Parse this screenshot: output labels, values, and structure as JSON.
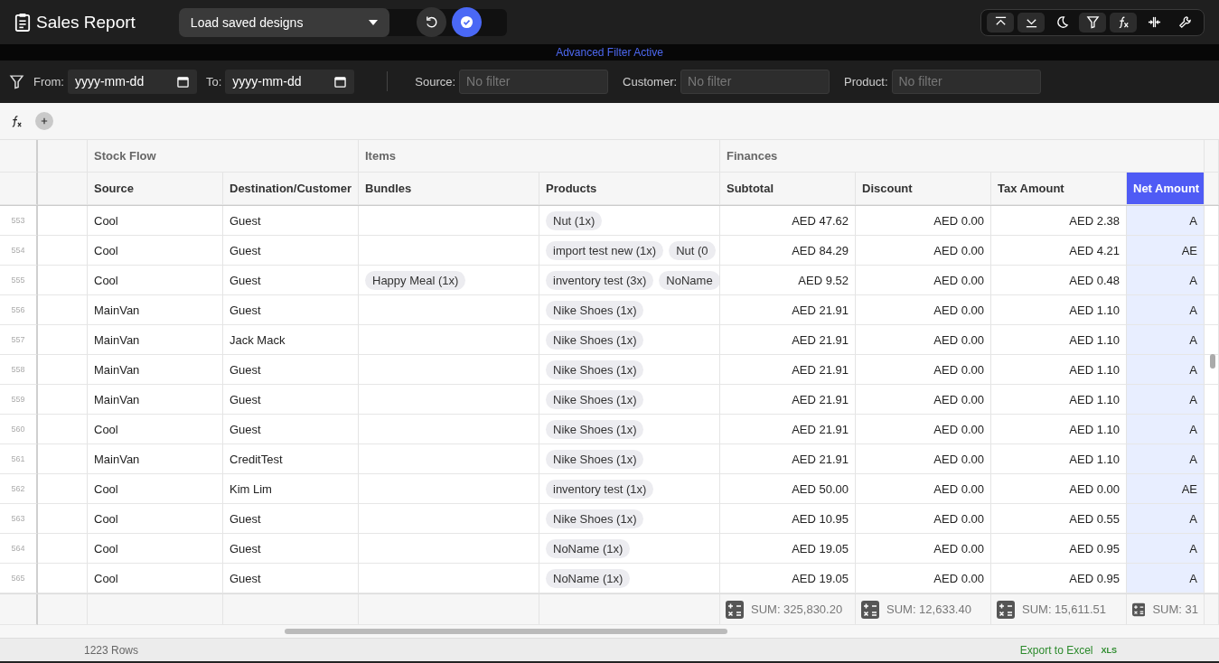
{
  "header": {
    "title": "Sales Report",
    "design_select": {
      "value": "Load saved designs"
    },
    "toolbar": [
      {
        "active": true
      },
      {
        "active": true
      },
      {
        "active": false
      },
      {
        "active": true
      },
      {
        "active": true
      },
      {
        "active": false
      },
      {
        "active": false
      }
    ]
  },
  "banner": {
    "text": "Advanced Filter Active"
  },
  "filters": {
    "dates": [
      {
        "label": "From:",
        "placeholder": "yyyy-mm-dd"
      },
      {
        "label": "To:",
        "placeholder": "yyyy-mm-dd"
      }
    ],
    "fields": [
      {
        "label": "Source:",
        "placeholder": "No filter"
      },
      {
        "label": "Customer:",
        "placeholder": "No filter"
      },
      {
        "label": "Product:",
        "placeholder": "No filter"
      }
    ]
  },
  "table": {
    "groups": [
      {
        "label": "Stock Flow",
        "columns": [
          {
            "label": "Source",
            "kind": "text",
            "selected": false
          },
          {
            "label": "Destination/Customer",
            "kind": "text",
            "selected": false
          }
        ]
      },
      {
        "label": "Items",
        "columns": [
          {
            "label": "Bundles",
            "kind": "chips",
            "selected": false
          },
          {
            "label": "Products",
            "kind": "chips",
            "selected": false
          }
        ]
      },
      {
        "label": "Finances",
        "columns": [
          {
            "label": "Subtotal",
            "kind": "money",
            "selected": false,
            "sum": "SUM: 325,830.20"
          },
          {
            "label": "Discount",
            "kind": "money",
            "selected": false,
            "sum": "SUM: 12,633.40"
          },
          {
            "label": "Tax Amount",
            "kind": "money",
            "selected": false,
            "sum": "SUM: 15,611.51"
          },
          {
            "label": "Net Amount",
            "kind": "money",
            "selected": true,
            "sum": "SUM: 31"
          }
        ]
      }
    ],
    "rows": [
      {
        "number": "553",
        "cells": [
          "Cool",
          "Guest",
          [],
          [
            "Nut (1x)"
          ],
          "AED 47.62",
          "AED 0.00",
          "AED 2.38",
          "A"
        ]
      },
      {
        "number": "554",
        "cells": [
          "Cool",
          "Guest",
          [],
          [
            "import test new (1x)",
            "Nut (0"
          ],
          "AED 84.29",
          "AED 0.00",
          "AED 4.21",
          "AE"
        ]
      },
      {
        "number": "555",
        "cells": [
          "Cool",
          "Guest",
          [
            "Happy Meal (1x)"
          ],
          [
            "inventory test (3x)",
            "NoName"
          ],
          "AED 9.52",
          "AED 0.00",
          "AED 0.48",
          "A"
        ]
      },
      {
        "number": "556",
        "cells": [
          "MainVan",
          "Guest",
          [],
          [
            "Nike Shoes (1x)"
          ],
          "AED 21.91",
          "AED 0.00",
          "AED 1.10",
          "A"
        ]
      },
      {
        "number": "557",
        "cells": [
          "MainVan",
          "Jack Mack",
          [],
          [
            "Nike Shoes (1x)"
          ],
          "AED 21.91",
          "AED 0.00",
          "AED 1.10",
          "A"
        ]
      },
      {
        "number": "558",
        "cells": [
          "MainVan",
          "Guest",
          [],
          [
            "Nike Shoes (1x)"
          ],
          "AED 21.91",
          "AED 0.00",
          "AED 1.10",
          "A"
        ]
      },
      {
        "number": "559",
        "cells": [
          "MainVan",
          "Guest",
          [],
          [
            "Nike Shoes (1x)"
          ],
          "AED 21.91",
          "AED 0.00",
          "AED 1.10",
          "A"
        ]
      },
      {
        "number": "560",
        "cells": [
          "Cool",
          "Guest",
          [],
          [
            "Nike Shoes (1x)"
          ],
          "AED 21.91",
          "AED 0.00",
          "AED 1.10",
          "A"
        ]
      },
      {
        "number": "561",
        "cells": [
          "MainVan",
          "CreditTest",
          [],
          [
            "Nike Shoes (1x)"
          ],
          "AED 21.91",
          "AED 0.00",
          "AED 1.10",
          "A"
        ]
      },
      {
        "number": "562",
        "cells": [
          "Cool",
          "Kim Lim",
          [],
          [
            "inventory test (1x)"
          ],
          "AED 50.00",
          "AED 0.00",
          "AED 0.00",
          "AE"
        ]
      },
      {
        "number": "563",
        "cells": [
          "Cool",
          "Guest",
          [],
          [
            "Nike Shoes (1x)"
          ],
          "AED 10.95",
          "AED 0.00",
          "AED 0.55",
          "A"
        ]
      },
      {
        "number": "564",
        "cells": [
          "Cool",
          "Guest",
          [],
          [
            "NoName (1x)"
          ],
          "AED 19.05",
          "AED 0.00",
          "AED 0.95",
          "A"
        ]
      },
      {
        "number": "565",
        "cells": [
          "Cool",
          "Guest",
          [],
          [
            "NoName (1x)"
          ],
          "AED 19.05",
          "AED 0.00",
          "AED 0.95",
          "A"
        ]
      }
    ]
  },
  "status": {
    "row_count": "1223 Rows",
    "export_link": "Export to Excel",
    "export_badge": "XLS"
  }
}
